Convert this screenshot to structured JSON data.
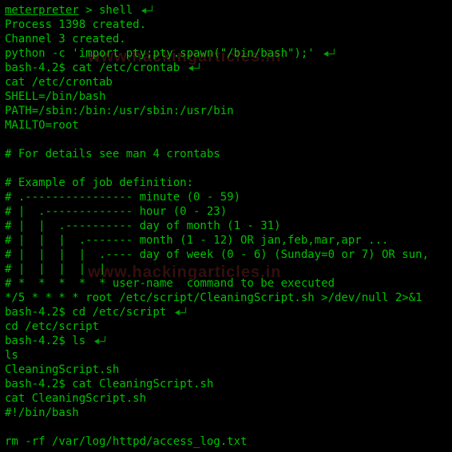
{
  "watermark": "www.hackingarticles.in",
  "lines": [
    {
      "segments": [
        {
          "text": "meterpreter",
          "underline": true
        },
        {
          "text": " > shell"
        }
      ],
      "arrow": true
    },
    {
      "segments": [
        {
          "text": "Process 1398 created."
        }
      ]
    },
    {
      "segments": [
        {
          "text": "Channel 3 created."
        }
      ]
    },
    {
      "segments": [
        {
          "text": "python -c 'import pty;pty.spawn(\"/bin/bash\");'"
        }
      ],
      "arrow": true
    },
    {
      "segments": [
        {
          "text": "bash-4.2$ cat /etc/crontab"
        }
      ],
      "arrow": true
    },
    {
      "segments": [
        {
          "text": "cat /etc/crontab"
        }
      ]
    },
    {
      "segments": [
        {
          "text": "SHELL=/bin/bash"
        }
      ]
    },
    {
      "segments": [
        {
          "text": "PATH=/sbin:/bin:/usr/sbin:/usr/bin"
        }
      ]
    },
    {
      "segments": [
        {
          "text": "MAILTO=root"
        }
      ]
    },
    {
      "segments": [
        {
          "text": ""
        }
      ]
    },
    {
      "segments": [
        {
          "text": "# For details see man 4 crontabs"
        }
      ]
    },
    {
      "segments": [
        {
          "text": ""
        }
      ]
    },
    {
      "segments": [
        {
          "text": "# Example of job definition:"
        }
      ]
    },
    {
      "segments": [
        {
          "text": "# .---------------- minute (0 - 59)"
        }
      ]
    },
    {
      "segments": [
        {
          "text": "# |  .------------- hour (0 - 23)"
        }
      ]
    },
    {
      "segments": [
        {
          "text": "# |  |  .---------- day of month (1 - 31)"
        }
      ]
    },
    {
      "segments": [
        {
          "text": "# |  |  |  .------- month (1 - 12) OR jan,feb,mar,apr ..."
        }
      ]
    },
    {
      "segments": [
        {
          "text": "# |  |  |  |  .---- day of week (0 - 6) (Sunday=0 or 7) OR sun,"
        }
      ]
    },
    {
      "segments": [
        {
          "text": "# |  |  |  |  |"
        }
      ]
    },
    {
      "segments": [
        {
          "text": "# *  *  *  *  * user-name  command to be executed"
        }
      ]
    },
    {
      "segments": [
        {
          "text": "*/5 * * * * root /etc/script/CleaningScript.sh >/dev/null 2>&1"
        }
      ]
    },
    {
      "segments": [
        {
          "text": "bash-4.2$ cd /etc/script"
        }
      ],
      "arrow": true
    },
    {
      "segments": [
        {
          "text": "cd /etc/script"
        }
      ]
    },
    {
      "segments": [
        {
          "text": "bash-4.2$ ls"
        }
      ],
      "arrow": true
    },
    {
      "segments": [
        {
          "text": "ls"
        }
      ]
    },
    {
      "segments": [
        {
          "text": "CleaningScript.sh"
        }
      ]
    },
    {
      "segments": [
        {
          "text": "bash-4.2$ cat CleaningScript.sh"
        }
      ]
    },
    {
      "segments": [
        {
          "text": "cat CleaningScript.sh"
        }
      ]
    },
    {
      "segments": [
        {
          "text": "#!/bin/bash"
        }
      ]
    },
    {
      "segments": [
        {
          "text": ""
        }
      ]
    },
    {
      "segments": [
        {
          "text": "rm -rf /var/log/httpd/access_log.txt"
        }
      ]
    }
  ]
}
